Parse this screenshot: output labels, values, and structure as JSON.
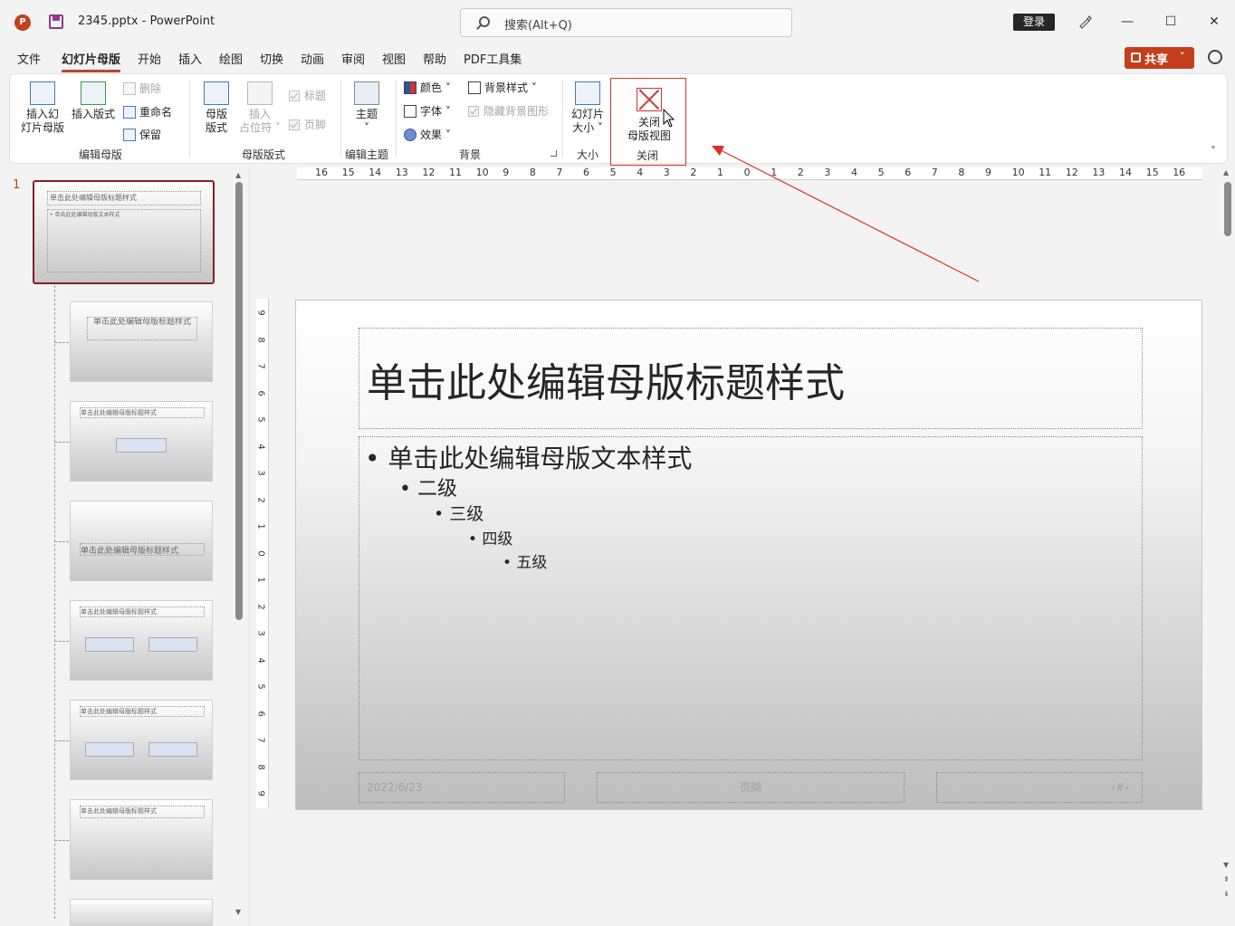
{
  "window": {
    "doc_title": "2345.pptx  -  PowerPoint",
    "search_placeholder": "搜索(Alt+Q)",
    "login_label": "登录",
    "app_logo": "P",
    "minimize": "—",
    "maximize": "☐",
    "close": "✕"
  },
  "menu": {
    "tabs": [
      "文件",
      "幻灯片母版",
      "开始",
      "插入",
      "绘图",
      "切换",
      "动画",
      "审阅",
      "视图",
      "帮助",
      "PDF工具集"
    ],
    "active": "幻灯片母版",
    "share_label": "共享"
  },
  "ribbon": {
    "groups": {
      "edit_master": "编辑母版",
      "master_layout": "母版版式",
      "edit_theme": "编辑主题",
      "background": "背景",
      "size": "大小",
      "close": "关闭"
    },
    "insert_slide_master": [
      "插入幻",
      "灯片母版"
    ],
    "insert_layout": "插入版式",
    "delete": "删除",
    "rename": "重命名",
    "preserve": "保留",
    "master_layout_btn": [
      "母版",
      "版式"
    ],
    "insert_placeholder": [
      "插入",
      "占位符 ˅"
    ],
    "title_cb": "标题",
    "footer_cb": "页脚",
    "themes": [
      "主题",
      "˅"
    ],
    "colors": "颜色 ˅",
    "fonts": "字体 ˅",
    "effects": "效果 ˅",
    "bg_styles": "背景样式 ˅",
    "hide_bg": "隐藏背景图形",
    "slide_size": [
      "幻灯片",
      "大小 ˅"
    ],
    "close_master": [
      "关闭",
      "母版视图"
    ],
    "collapse": "˅"
  },
  "thumbnails": {
    "slide_number": "1",
    "main_title": "单击此处编辑母版标题样式",
    "main_body": "• 单击此处编辑母版文本样式",
    "layout_titles": [
      "单击此处编辑母版标题样式",
      "单击此处编辑母版标题样式",
      "单击此处编辑母版标题样式",
      "单击此处编辑母版标题样式",
      "单击此处编辑母版标题样式",
      "单击此处编辑母版标题样式"
    ]
  },
  "slide": {
    "title": "单击此处编辑母版标题样式",
    "levels": [
      "• 单击此处编辑母版文本样式",
      "• 二级",
      "• 三级",
      "• 四级",
      "• 五级"
    ],
    "date": "2022/6/23",
    "footer": "页脚",
    "page_num": "‹#›"
  },
  "rulers": {
    "horizontal": [
      "16",
      "15",
      "14",
      "13",
      "12",
      "11",
      "10",
      "9",
      "8",
      "7",
      "6",
      "5",
      "4",
      "3",
      "2",
      "1",
      "0",
      "1",
      "2",
      "3",
      "4",
      "5",
      "6",
      "7",
      "8",
      "9",
      "10",
      "11",
      "12",
      "13",
      "14",
      "15",
      "16"
    ],
    "vertical": [
      "9",
      "8",
      "7",
      "6",
      "5",
      "4",
      "3",
      "2",
      "1",
      "0",
      "1",
      "2",
      "3",
      "4",
      "5",
      "6",
      "7",
      "8",
      "9"
    ]
  }
}
